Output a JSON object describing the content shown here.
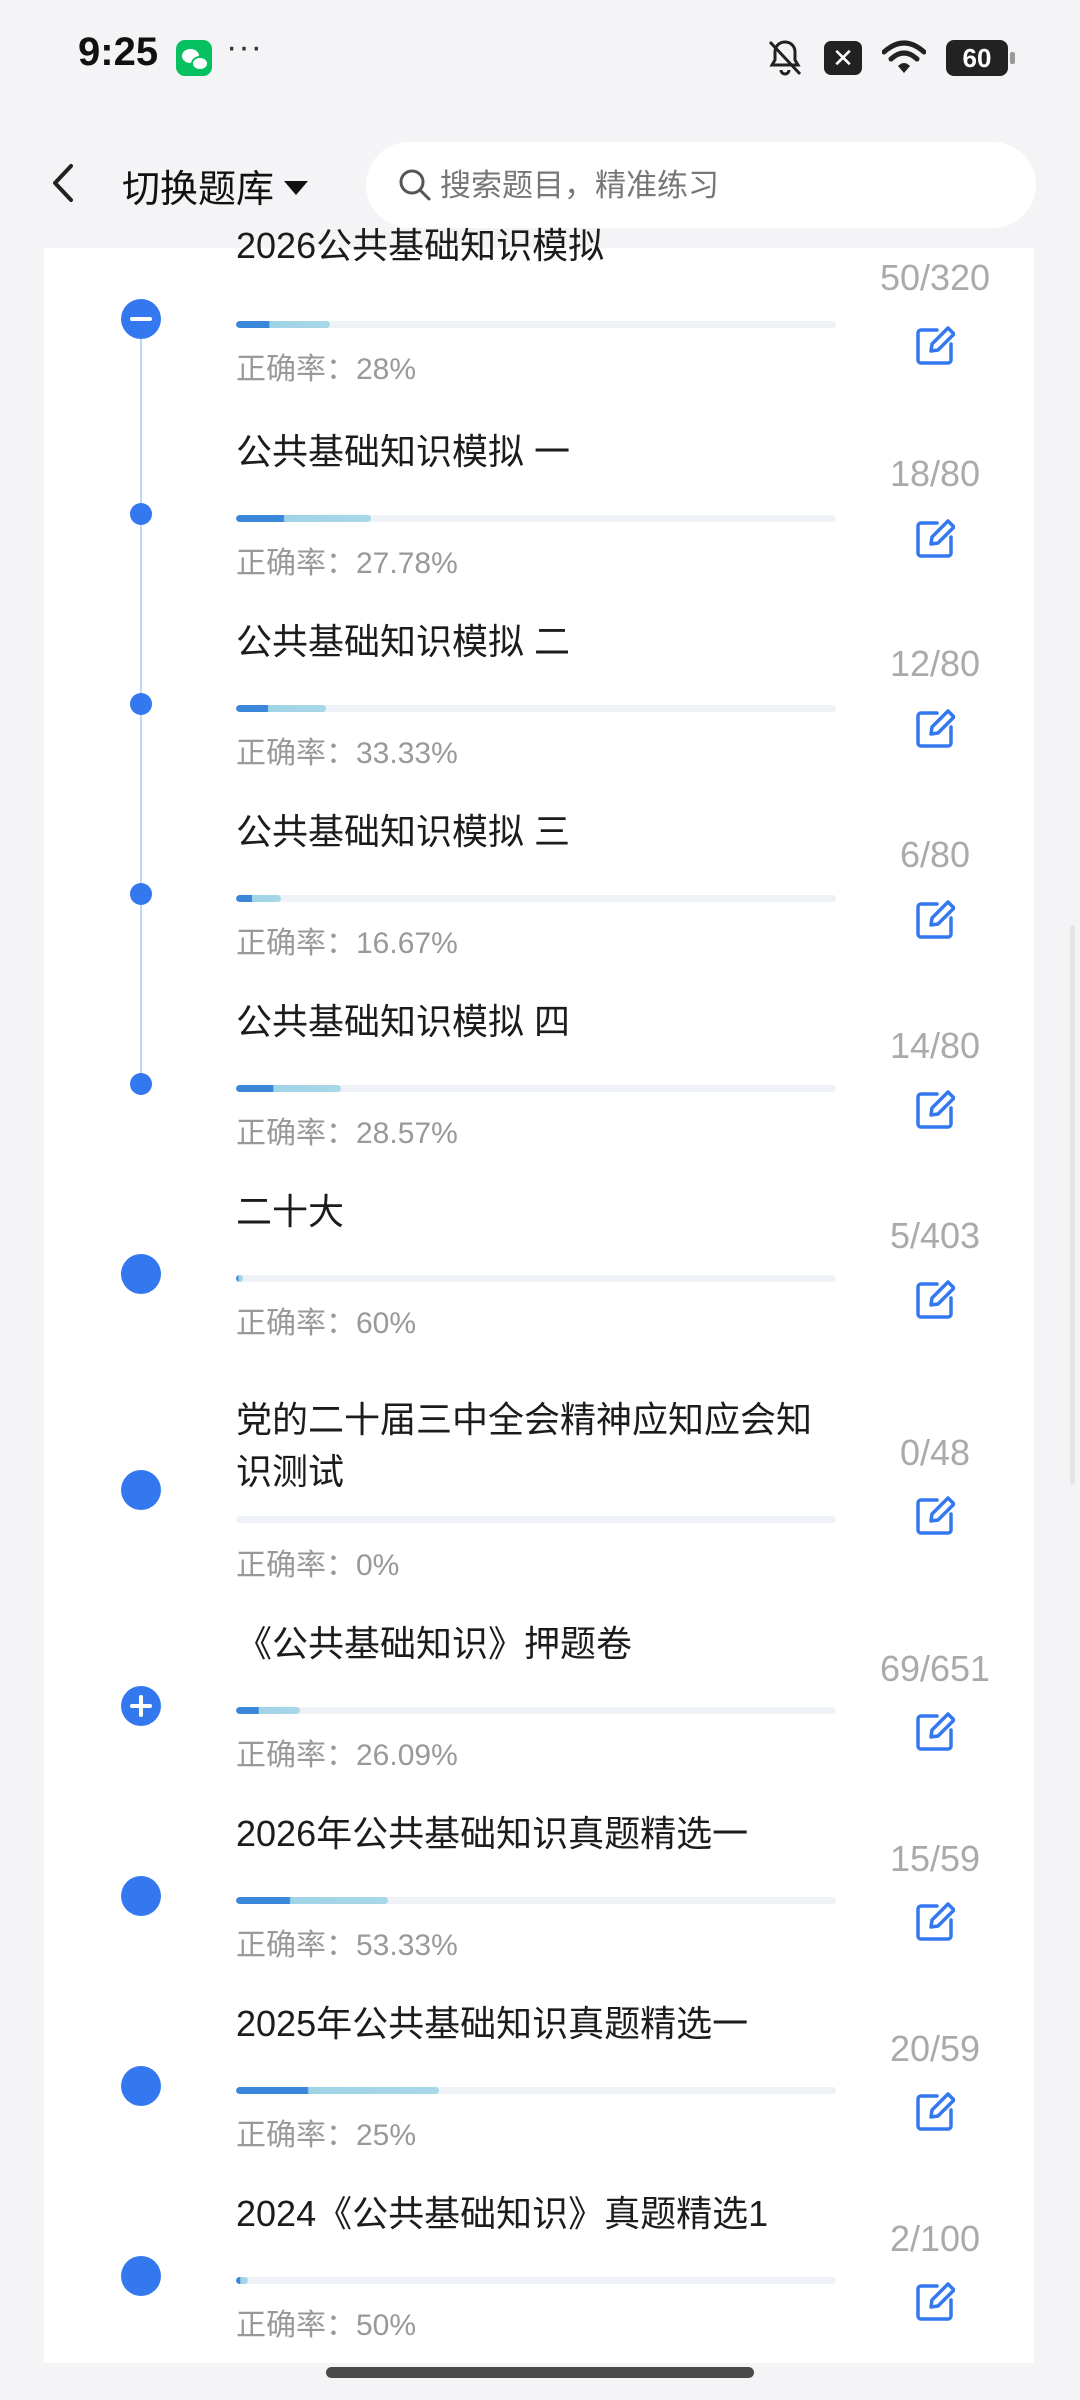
{
  "status_bar": {
    "time": "9:25",
    "dots": "···",
    "battery": "60",
    "notif": "✕"
  },
  "header": {
    "switch_label": "切换题库",
    "search_placeholder": "搜索题目，精准练习"
  },
  "colors": {
    "accent": "#3478f0",
    "bar_dark": "#3a86d8",
    "bar_light": "#a8d8e8",
    "count_gray": "#aaaaaa"
  },
  "items": [
    {
      "title": "2026公共基础知识模拟",
      "accuracy": "正确率：28%",
      "count": "50/320",
      "progress": 0.156,
      "node": "minus"
    },
    {
      "title": "公共基础知识模拟 一",
      "accuracy": "正确率：27.78%",
      "count": "18/80",
      "progress": 0.225,
      "node": "small"
    },
    {
      "title": "公共基础知识模拟 二",
      "accuracy": "正确率：33.33%",
      "count": "12/80",
      "progress": 0.15,
      "node": "small"
    },
    {
      "title": "公共基础知识模拟 三",
      "accuracy": "正确率：16.67%",
      "count": "6/80",
      "progress": 0.075,
      "node": "small"
    },
    {
      "title": "公共基础知识模拟 四",
      "accuracy": "正确率：28.57%",
      "count": "14/80",
      "progress": 0.175,
      "node": "small"
    },
    {
      "title": "二十大",
      "accuracy": "正确率：60%",
      "count": "5/403",
      "progress": 0.012,
      "node": "large"
    },
    {
      "title": "党的二十届三中全会精神应知应会知识测试",
      "accuracy": "正确率：0%",
      "count": "0/48",
      "progress": 0.0,
      "node": "large"
    },
    {
      "title": "《公共基础知识》押题卷",
      "accuracy": "正确率：26.09%",
      "count": "69/651",
      "progress": 0.106,
      "node": "plus"
    },
    {
      "title": "2026年公共基础知识真题精选一",
      "accuracy": "正确率：53.33%",
      "count": "15/59",
      "progress": 0.254,
      "node": "large"
    },
    {
      "title": "2025年公共基础知识真题精选一",
      "accuracy": "正确率：25%",
      "count": "20/59",
      "progress": 0.339,
      "node": "large"
    },
    {
      "title": "2024《公共基础知识》真题精选1",
      "accuracy": "正确率：50%",
      "count": "2/100",
      "progress": 0.02,
      "node": "large"
    }
  ]
}
